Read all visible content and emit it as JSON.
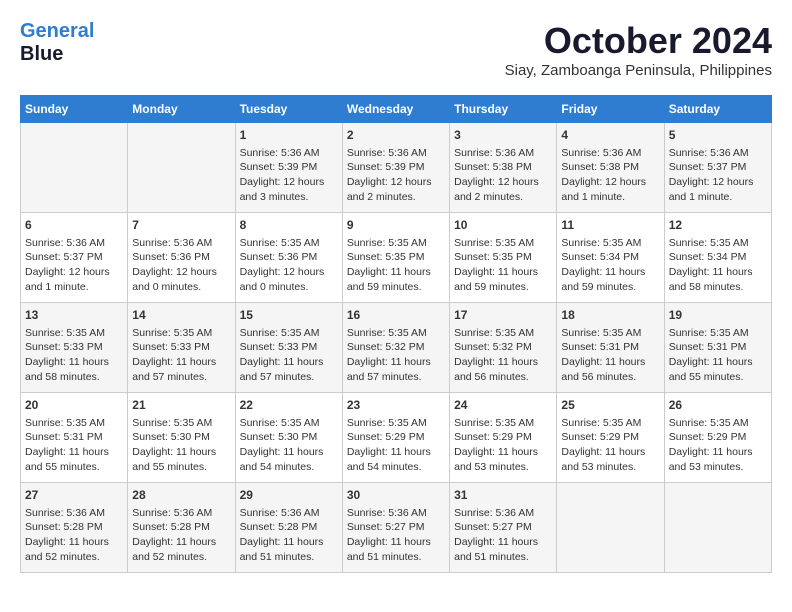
{
  "logo": {
    "line1": "General",
    "line2": "Blue"
  },
  "title": "October 2024",
  "location": "Siay, Zamboanga Peninsula, Philippines",
  "headers": [
    "Sunday",
    "Monday",
    "Tuesday",
    "Wednesday",
    "Thursday",
    "Friday",
    "Saturday"
  ],
  "weeks": [
    [
      {
        "day": "",
        "info": ""
      },
      {
        "day": "",
        "info": ""
      },
      {
        "day": "1",
        "info": "Sunrise: 5:36 AM\nSunset: 5:39 PM\nDaylight: 12 hours\nand 3 minutes."
      },
      {
        "day": "2",
        "info": "Sunrise: 5:36 AM\nSunset: 5:39 PM\nDaylight: 12 hours\nand 2 minutes."
      },
      {
        "day": "3",
        "info": "Sunrise: 5:36 AM\nSunset: 5:38 PM\nDaylight: 12 hours\nand 2 minutes."
      },
      {
        "day": "4",
        "info": "Sunrise: 5:36 AM\nSunset: 5:38 PM\nDaylight: 12 hours\nand 1 minute."
      },
      {
        "day": "5",
        "info": "Sunrise: 5:36 AM\nSunset: 5:37 PM\nDaylight: 12 hours\nand 1 minute."
      }
    ],
    [
      {
        "day": "6",
        "info": "Sunrise: 5:36 AM\nSunset: 5:37 PM\nDaylight: 12 hours\nand 1 minute."
      },
      {
        "day": "7",
        "info": "Sunrise: 5:36 AM\nSunset: 5:36 PM\nDaylight: 12 hours\nand 0 minutes."
      },
      {
        "day": "8",
        "info": "Sunrise: 5:35 AM\nSunset: 5:36 PM\nDaylight: 12 hours\nand 0 minutes."
      },
      {
        "day": "9",
        "info": "Sunrise: 5:35 AM\nSunset: 5:35 PM\nDaylight: 11 hours\nand 59 minutes."
      },
      {
        "day": "10",
        "info": "Sunrise: 5:35 AM\nSunset: 5:35 PM\nDaylight: 11 hours\nand 59 minutes."
      },
      {
        "day": "11",
        "info": "Sunrise: 5:35 AM\nSunset: 5:34 PM\nDaylight: 11 hours\nand 59 minutes."
      },
      {
        "day": "12",
        "info": "Sunrise: 5:35 AM\nSunset: 5:34 PM\nDaylight: 11 hours\nand 58 minutes."
      }
    ],
    [
      {
        "day": "13",
        "info": "Sunrise: 5:35 AM\nSunset: 5:33 PM\nDaylight: 11 hours\nand 58 minutes."
      },
      {
        "day": "14",
        "info": "Sunrise: 5:35 AM\nSunset: 5:33 PM\nDaylight: 11 hours\nand 57 minutes."
      },
      {
        "day": "15",
        "info": "Sunrise: 5:35 AM\nSunset: 5:33 PM\nDaylight: 11 hours\nand 57 minutes."
      },
      {
        "day": "16",
        "info": "Sunrise: 5:35 AM\nSunset: 5:32 PM\nDaylight: 11 hours\nand 57 minutes."
      },
      {
        "day": "17",
        "info": "Sunrise: 5:35 AM\nSunset: 5:32 PM\nDaylight: 11 hours\nand 56 minutes."
      },
      {
        "day": "18",
        "info": "Sunrise: 5:35 AM\nSunset: 5:31 PM\nDaylight: 11 hours\nand 56 minutes."
      },
      {
        "day": "19",
        "info": "Sunrise: 5:35 AM\nSunset: 5:31 PM\nDaylight: 11 hours\nand 55 minutes."
      }
    ],
    [
      {
        "day": "20",
        "info": "Sunrise: 5:35 AM\nSunset: 5:31 PM\nDaylight: 11 hours\nand 55 minutes."
      },
      {
        "day": "21",
        "info": "Sunrise: 5:35 AM\nSunset: 5:30 PM\nDaylight: 11 hours\nand 55 minutes."
      },
      {
        "day": "22",
        "info": "Sunrise: 5:35 AM\nSunset: 5:30 PM\nDaylight: 11 hours\nand 54 minutes."
      },
      {
        "day": "23",
        "info": "Sunrise: 5:35 AM\nSunset: 5:29 PM\nDaylight: 11 hours\nand 54 minutes."
      },
      {
        "day": "24",
        "info": "Sunrise: 5:35 AM\nSunset: 5:29 PM\nDaylight: 11 hours\nand 53 minutes."
      },
      {
        "day": "25",
        "info": "Sunrise: 5:35 AM\nSunset: 5:29 PM\nDaylight: 11 hours\nand 53 minutes."
      },
      {
        "day": "26",
        "info": "Sunrise: 5:35 AM\nSunset: 5:29 PM\nDaylight: 11 hours\nand 53 minutes."
      }
    ],
    [
      {
        "day": "27",
        "info": "Sunrise: 5:36 AM\nSunset: 5:28 PM\nDaylight: 11 hours\nand 52 minutes."
      },
      {
        "day": "28",
        "info": "Sunrise: 5:36 AM\nSunset: 5:28 PM\nDaylight: 11 hours\nand 52 minutes."
      },
      {
        "day": "29",
        "info": "Sunrise: 5:36 AM\nSunset: 5:28 PM\nDaylight: 11 hours\nand 51 minutes."
      },
      {
        "day": "30",
        "info": "Sunrise: 5:36 AM\nSunset: 5:27 PM\nDaylight: 11 hours\nand 51 minutes."
      },
      {
        "day": "31",
        "info": "Sunrise: 5:36 AM\nSunset: 5:27 PM\nDaylight: 11 hours\nand 51 minutes."
      },
      {
        "day": "",
        "info": ""
      },
      {
        "day": "",
        "info": ""
      }
    ]
  ]
}
